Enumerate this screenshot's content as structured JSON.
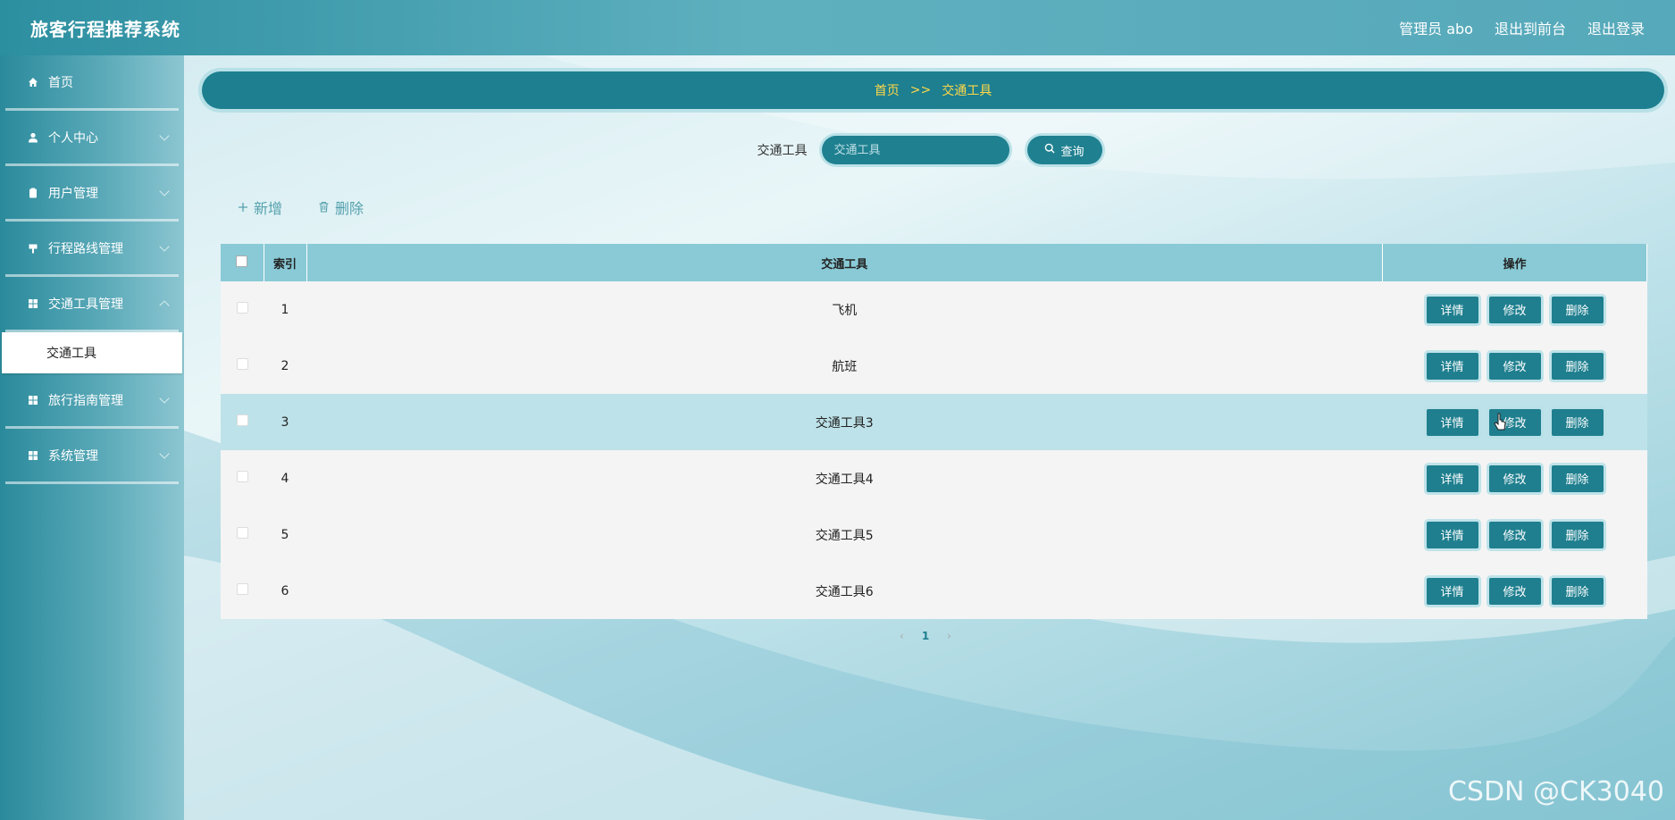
{
  "app": {
    "title": "旅客行程推荐系统",
    "user_label": "管理员 abo",
    "to_front_label": "退出到前台",
    "logout_label": "退出登录"
  },
  "sidebar": {
    "items": [
      {
        "label": "首页",
        "icon": "home-icon"
      },
      {
        "label": "个人中心",
        "icon": "user-icon"
      },
      {
        "label": "用户管理",
        "icon": "clipboard-icon"
      },
      {
        "label": "行程路线管理",
        "icon": "route-icon"
      },
      {
        "label": "交通工具管理",
        "icon": "grid-icon"
      },
      {
        "label": "旅行指南管理",
        "icon": "grid-icon"
      },
      {
        "label": "系统管理",
        "icon": "grid-icon"
      }
    ],
    "active_sub_label": "交通工具"
  },
  "breadcrumb": {
    "home": "首页",
    "separator": ">>",
    "current": "交通工具"
  },
  "search": {
    "label": "交通工具",
    "placeholder": "交通工具",
    "button_label": "查询"
  },
  "actions": {
    "add_label": "新增",
    "delete_label": "删除"
  },
  "table": {
    "headers": {
      "index": "索引",
      "name": "交通工具",
      "ops": "操作"
    },
    "rows": [
      {
        "index": "1",
        "name": "飞机"
      },
      {
        "index": "2",
        "name": "航班"
      },
      {
        "index": "3",
        "name": "交通工具3"
      },
      {
        "index": "4",
        "name": "交通工具4"
      },
      {
        "index": "5",
        "name": "交通工具5"
      },
      {
        "index": "6",
        "name": "交通工具6"
      }
    ],
    "op_labels": {
      "detail": "详情",
      "edit": "修改",
      "delete": "删除"
    }
  },
  "pagination": {
    "current_page": "1"
  },
  "watermark": "CSDN @CK3040",
  "colors": {
    "primary": "#1f8090",
    "breadcrumb_text": "#ffd84a",
    "table_header": "#89cad6"
  }
}
